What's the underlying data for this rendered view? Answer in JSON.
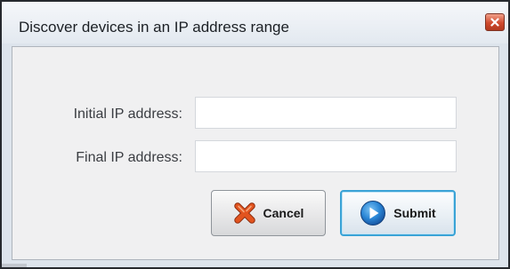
{
  "window": {
    "title": "Discover devices in an IP address range"
  },
  "form": {
    "initial_label": "Initial IP address:",
    "initial_value": "",
    "final_label": "Final IP address:",
    "final_value": ""
  },
  "buttons": {
    "cancel_label": "Cancel",
    "submit_label": "Submit"
  },
  "icons": {
    "close": "close-icon",
    "cancel": "red-x-icon",
    "submit": "blue-play-icon"
  },
  "colors": {
    "close_button": "#cf4a2d",
    "cancel_icon": "#e2541f",
    "submit_icon": "#1e73c8",
    "submit_border": "#3aa3d6"
  }
}
